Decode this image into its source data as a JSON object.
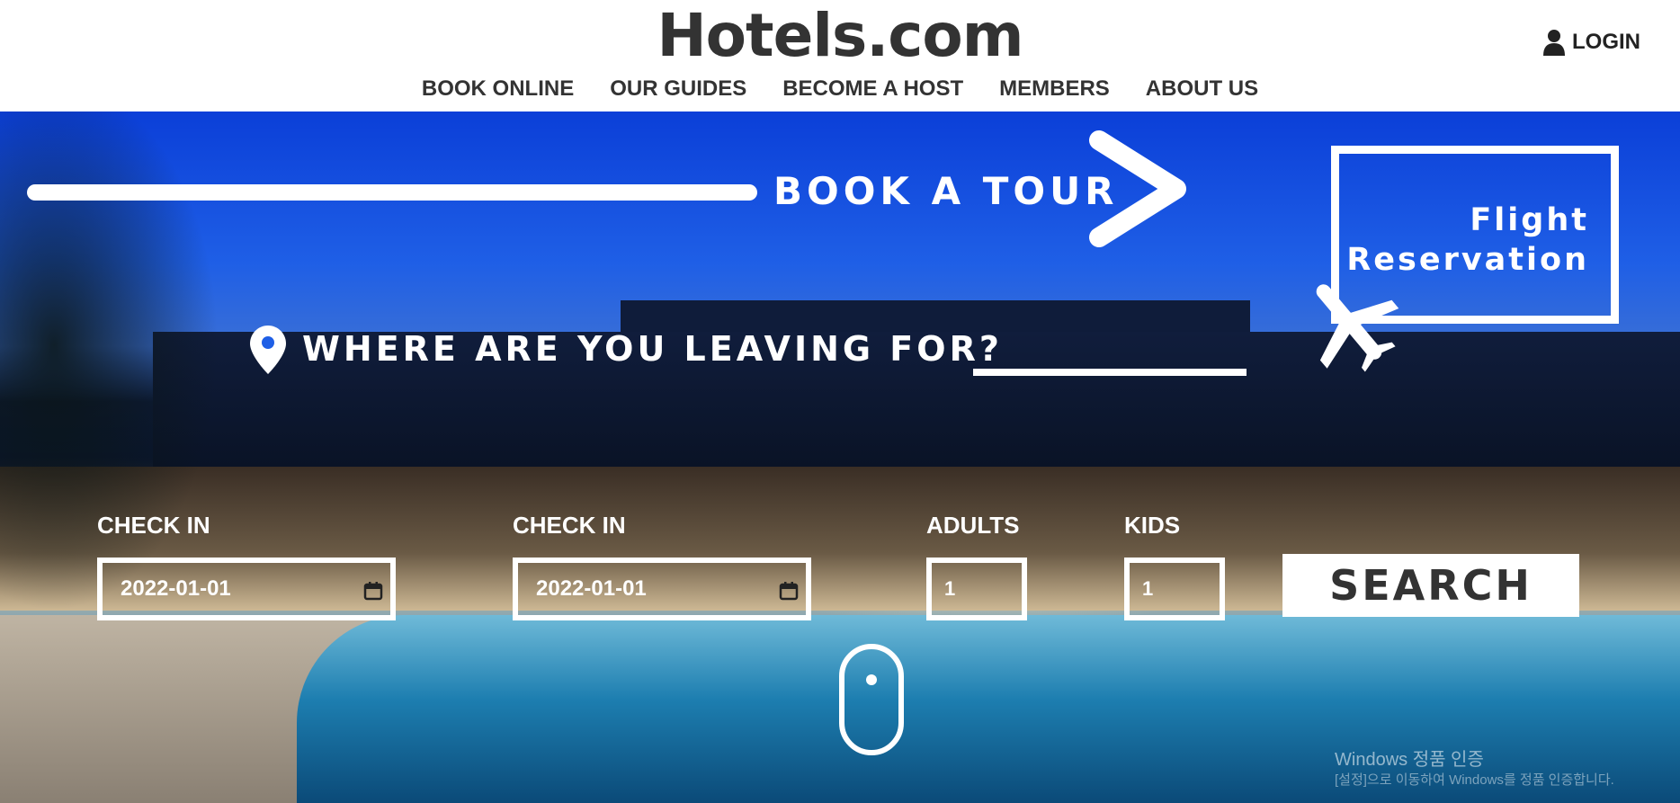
{
  "header": {
    "logo": "Hotels.com",
    "nav": [
      "BOOK ONLINE",
      "OUR GUIDES",
      "BECOME A HOST",
      "MEMBERS",
      "ABOUT US"
    ],
    "login_label": "LOGIN",
    "login_icon": "user-icon"
  },
  "hero": {
    "book_tour_label": "BOOK A TOUR",
    "flight_label_line1": "Flight",
    "flight_label_line2": "Reservation",
    "where_label": "WHERE ARE YOU LEAVING FOR?",
    "where_value": "",
    "search_form": {
      "check_in_label": "CHECK IN",
      "check_in_value": "2022-01-01",
      "check_out_label": "CHECK IN",
      "check_out_value": "2022-01-01",
      "adults_label": "ADULTS",
      "adults_value": "1",
      "kids_label": "KIDS",
      "kids_value": "1",
      "search_label": "SEARCH"
    }
  },
  "watermark": {
    "line1": "Windows 정품 인증",
    "line2": "[설정]으로 이동하여 Windows를 정품 인증합니다."
  },
  "colors": {
    "text_dark": "#333333",
    "hero_blue": "#1f5fe6",
    "white": "#ffffff"
  }
}
